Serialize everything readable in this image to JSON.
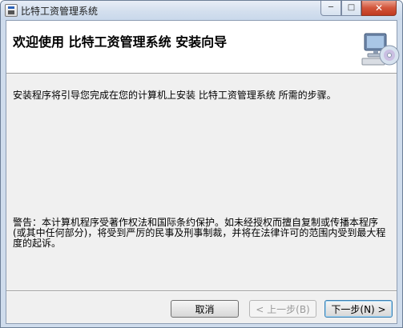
{
  "window": {
    "title": "比特工资管理系统",
    "controls": {
      "minimize": "─",
      "maximize": "□",
      "close": "✕"
    }
  },
  "header": {
    "title": "欢迎使用  比特工资管理系统  安装向导",
    "art_icon": "computer-cd-icon"
  },
  "body": {
    "intro": "安装程序将引导您完成在您的计算机上安装 比特工资管理系统 所需的步骤。",
    "warning": "警告：本计算机程序受著作权法和国际条约保护。如未经授权而擅自复制或传播本程序(或其中任何部分)，将受到严厉的民事及刑事制裁，并将在法律许可的范围内受到最大程度的起诉。"
  },
  "buttons": {
    "cancel": "取消",
    "back": "< 上一步(B)",
    "next": "下一步(N) >"
  },
  "colors": {
    "frame": "#cfdcec",
    "client": "#f0f0f0",
    "header": "#ffffff",
    "close_button": "#c9452b"
  }
}
